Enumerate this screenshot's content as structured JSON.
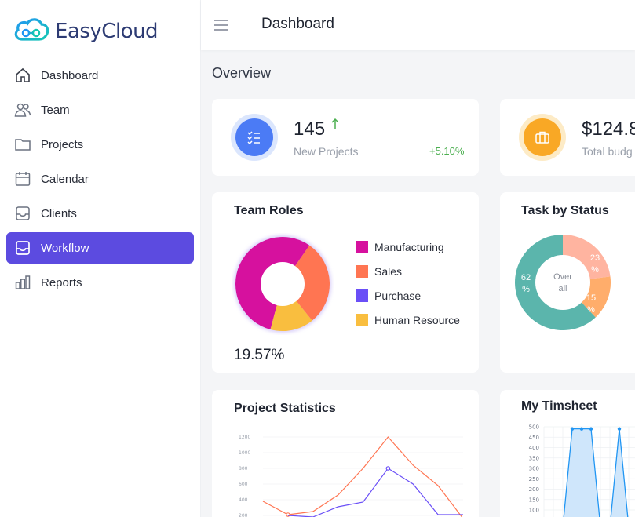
{
  "app": {
    "name": "EasyCloud"
  },
  "sidebar": {
    "items": [
      {
        "label": "Dashboard",
        "icon": "home-icon",
        "active": false
      },
      {
        "label": "Team",
        "icon": "users-icon",
        "active": false
      },
      {
        "label": "Projects",
        "icon": "folder-icon",
        "active": false
      },
      {
        "label": "Calendar",
        "icon": "calendar-icon",
        "active": false
      },
      {
        "label": "Clients",
        "icon": "inbox-icon",
        "active": false
      },
      {
        "label": "Workflow",
        "icon": "inbox-icon",
        "active": true
      },
      {
        "label": "Reports",
        "icon": "bar-chart-icon",
        "active": false
      }
    ]
  },
  "header": {
    "title": "Dashboard"
  },
  "main": {
    "section_title": "Overview",
    "stats": [
      {
        "value": "145",
        "label": "New Projects",
        "change": "+5.10%",
        "icon": "checklist-icon",
        "color": "#4b7bf5"
      },
      {
        "value": "$124.8",
        "label": "Total budg",
        "icon": "briefcase-icon",
        "color": "#f9a825"
      }
    ],
    "team_roles": {
      "title": "Team Roles",
      "percent": "19.57%",
      "legend": [
        "Manufacturing",
        "Sales",
        "Purchase",
        "Human Resource"
      ]
    },
    "task_status": {
      "title": "Task by Status",
      "center_line1": "Over",
      "center_line2": "all",
      "labels": [
        {
          "top": "62",
          "bottom": "%"
        },
        {
          "top": "23",
          "bottom": "%"
        },
        {
          "top": "15",
          "bottom": "%"
        }
      ]
    },
    "project_statistics": {
      "title": "Project Statistics"
    },
    "timesheet": {
      "title": "My Timsheet"
    }
  },
  "colors": {
    "accent": "#5c4be0",
    "manufacturing": "#d6119e",
    "sales": "#ff7552",
    "purchase": "#6a4ff7",
    "human_resource": "#f9be3f",
    "teal": "#5bb5ac",
    "salmon": "#ffb4a0",
    "orange": "#ffad6b",
    "positive": "#4caf50"
  },
  "chart_data": [
    {
      "type": "pie",
      "title": "Team Roles",
      "labels": [
        "Manufacturing",
        "Sales",
        "Purchase",
        "Human Resource"
      ],
      "values": [
        55.5,
        29.5,
        0,
        15
      ]
    },
    {
      "type": "pie",
      "title": "Task by Status",
      "labels": [
        "62 %",
        "23 %",
        "15 %"
      ],
      "values": [
        62,
        23,
        15
      ]
    },
    {
      "type": "line",
      "title": "Project Statistics",
      "ylim": [
        200,
        1200
      ],
      "y_ticks": [
        "1200",
        "1000",
        "800",
        "600",
        "400",
        "200"
      ],
      "series": [
        {
          "values": [
            380,
            210,
            250,
            460,
            800,
            1200,
            840,
            580,
            140
          ]
        },
        {
          "values": [
            null,
            200,
            180,
            310,
            370,
            800,
            600,
            210,
            210
          ]
        }
      ]
    },
    {
      "type": "area",
      "title": "My Timsheet",
      "ylim": [
        100,
        500
      ],
      "y_ticks": [
        "500",
        "450",
        "400",
        "350",
        "300",
        "250",
        "200",
        "150",
        "100"
      ],
      "series": [
        {
          "values": [
            0,
            0,
            490,
            490,
            490,
            0,
            0,
            490,
            0,
            0,
            0,
            0
          ]
        }
      ]
    }
  ]
}
